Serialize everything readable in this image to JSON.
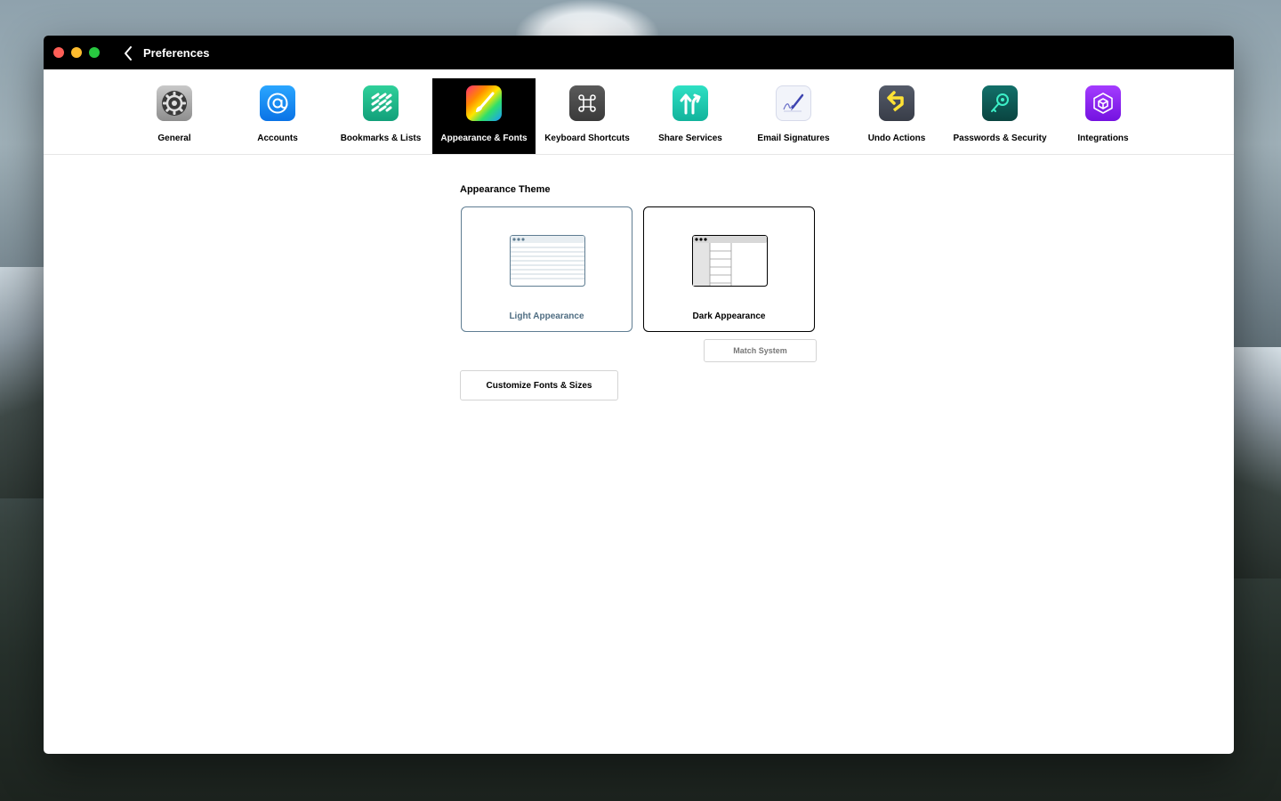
{
  "window": {
    "title": "Preferences"
  },
  "tabs": [
    {
      "label": "General",
      "icon": "gear-icon",
      "color": "#8c8c8c"
    },
    {
      "label": "Accounts",
      "icon": "at-sign-icon",
      "color": "#0a84ff"
    },
    {
      "label": "Bookmarks & Lists",
      "icon": "stacked-lines-icon",
      "color": "#1eb88a"
    },
    {
      "label": "Appearance & Fonts",
      "icon": "paintbrush-icon",
      "color": "#ff3b8d",
      "selected": true
    },
    {
      "label": "Keyboard Shortcuts",
      "icon": "command-key-icon",
      "color": "#4a4a4a"
    },
    {
      "label": "Share Services",
      "icon": "share-arrows-icon",
      "color": "#1cc9b0"
    },
    {
      "label": "Email Signatures",
      "icon": "signature-pen-icon",
      "color": "#eef0f8"
    },
    {
      "label": "Undo Actions",
      "icon": "undo-arrow-icon",
      "color": "#444a58"
    },
    {
      "label": "Passwords & Security",
      "icon": "key-icon",
      "color": "#0d5a55"
    },
    {
      "label": "Integrations",
      "icon": "cube-icon",
      "color": "#8a1cf0"
    }
  ],
  "appearance": {
    "section_title": "Appearance Theme",
    "options": [
      {
        "label": "Light Appearance",
        "state": "selected"
      },
      {
        "label": "Dark Appearance",
        "state": "unselected"
      }
    ],
    "match_system_button": "Match System",
    "customize_fonts_button": "Customize Fonts & Sizes"
  }
}
